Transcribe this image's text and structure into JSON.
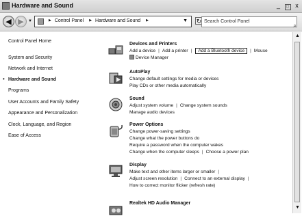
{
  "window": {
    "title": "Hardware and Sound",
    "controls": [
      "_",
      "□",
      "x"
    ]
  },
  "nav": {
    "back": "◀",
    "forward": "▶",
    "breadcrumb": [
      "Control Panel",
      "Hardware and Sound"
    ],
    "search_placeholder": "Search Control Panel"
  },
  "sidebar": {
    "items": [
      "Control Panel Home",
      "System and Security",
      "Network and Internet",
      "Hardware and Sound",
      "Programs",
      "User Accounts and Family Safety",
      "Appearance and Personalization",
      "Clock, Language, and Region",
      "Ease of Access"
    ],
    "active_index": 3
  },
  "sections": {
    "devices": {
      "title": "Devices and Printers",
      "links": [
        "Add a device",
        "Add a printer",
        "Add a Bluetooth device",
        "Mouse",
        "Device Manager"
      ]
    },
    "autoplay": {
      "title": "AutoPlay",
      "links": [
        "Change default settings for media or devices",
        "Play CDs or other media automatically"
      ]
    },
    "sound": {
      "title": "Sound",
      "links": [
        "Adjust system volume",
        "Change system sounds",
        "Manage audio devices"
      ]
    },
    "power": {
      "title": "Power Options",
      "links": [
        "Change power-saving settings",
        "Change what the power buttons do",
        "Require a password when the computer wakes",
        "Change when the computer sleeps",
        "Choose a power plan"
      ]
    },
    "display": {
      "title": "Display",
      "links": [
        "Make text and other items larger or smaller",
        "Adjust screen resolution",
        "Connect to an external display",
        "How to correct monitor flicker (refresh rate)"
      ]
    },
    "realtek": {
      "title": "Realtek HD Audio Manager"
    }
  }
}
